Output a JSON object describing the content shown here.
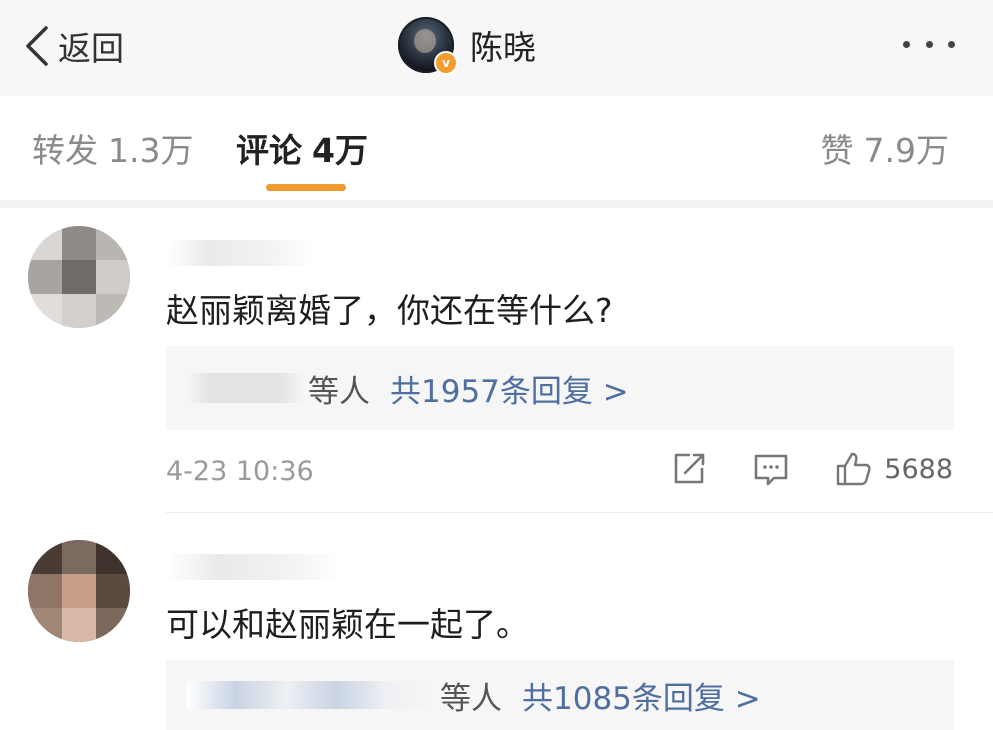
{
  "header": {
    "back_label": "返回",
    "title": "陈晓",
    "verified_badge": "v"
  },
  "tabs": [
    {
      "label": "转发",
      "count": "1.3万"
    },
    {
      "label": "评论",
      "count": "4万"
    },
    {
      "label": "赞",
      "count": "7.9万"
    }
  ],
  "comments": [
    {
      "text": "赵丽颖离婚了，你还在等什么?",
      "reply_who": "等人",
      "reply_count": "共1957条回复 >",
      "time": "4-23 10:36",
      "likes": "5688"
    },
    {
      "text": "可以和赵丽颖在一起了。",
      "reply_who": "等人",
      "reply_count": "共1085条回复 >"
    }
  ],
  "colors": {
    "accent": "#ee9a2e",
    "link": "#4f6fa0",
    "badge": "#f29d2c"
  },
  "icons": [
    "chevron-left-icon",
    "more-icon",
    "share-icon",
    "comment-icon",
    "thumbs-up-icon"
  ]
}
